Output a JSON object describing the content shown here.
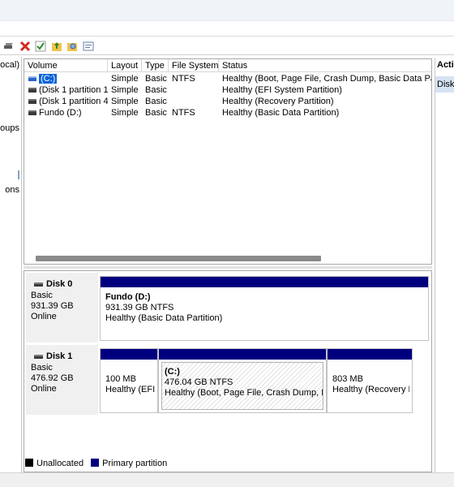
{
  "left_pane": {
    "frags": [
      "ocal)",
      "oups",
      "ons"
    ]
  },
  "volumes": {
    "columns": [
      "Volume",
      "Layout",
      "Type",
      "File System",
      "Status"
    ],
    "rows": [
      {
        "name": "(C:)",
        "layout": "Simple",
        "type": "Basic",
        "fs": "NTFS",
        "status": "Healthy (Boot, Page File, Crash Dump, Basic Data Partition)",
        "icon": "volume-blue-icon",
        "selected": true
      },
      {
        "name": "(Disk 1 partition 1)",
        "layout": "Simple",
        "type": "Basic",
        "fs": "",
        "status": "Healthy (EFI System Partition)",
        "icon": "volume-icon",
        "selected": false
      },
      {
        "name": "(Disk 1 partition 4)",
        "layout": "Simple",
        "type": "Basic",
        "fs": "",
        "status": "Healthy (Recovery Partition)",
        "icon": "volume-icon",
        "selected": false
      },
      {
        "name": "Fundo (D:)",
        "layout": "Simple",
        "type": "Basic",
        "fs": "NTFS",
        "status": "Healthy (Basic Data Partition)",
        "icon": "volume-icon",
        "selected": false
      }
    ]
  },
  "disks": [
    {
      "name": "Disk 0",
      "type": "Basic",
      "size": "931.39 GB",
      "state": "Online",
      "partitions": [
        {
          "name": "Fundo  (D:)",
          "size": "931.39 GB NTFS",
          "status": "Healthy (Basic Data Partition)"
        }
      ]
    },
    {
      "name": "Disk 1",
      "type": "Basic",
      "size": "476.92 GB",
      "state": "Online",
      "partitions": [
        {
          "name": "",
          "size": "100 MB",
          "status": "Healthy (EFI S"
        },
        {
          "name": "(C:)",
          "size": "476.04 GB NTFS",
          "status": "Healthy (Boot, Page File, Crash Dump, Basic"
        },
        {
          "name": "",
          "size": "803 MB",
          "status": "Healthy (Recovery Pa"
        }
      ]
    }
  ],
  "legend": [
    {
      "label": "Unallocated",
      "color": "#000000"
    },
    {
      "label": "Primary partition",
      "color": "#00007f"
    }
  ],
  "actions": {
    "title": "Acti",
    "item": "Disk"
  },
  "colors": {
    "primary_partition": "#00007f",
    "selection": "#0a64d8",
    "action_highlight": "#d6e3f3"
  }
}
